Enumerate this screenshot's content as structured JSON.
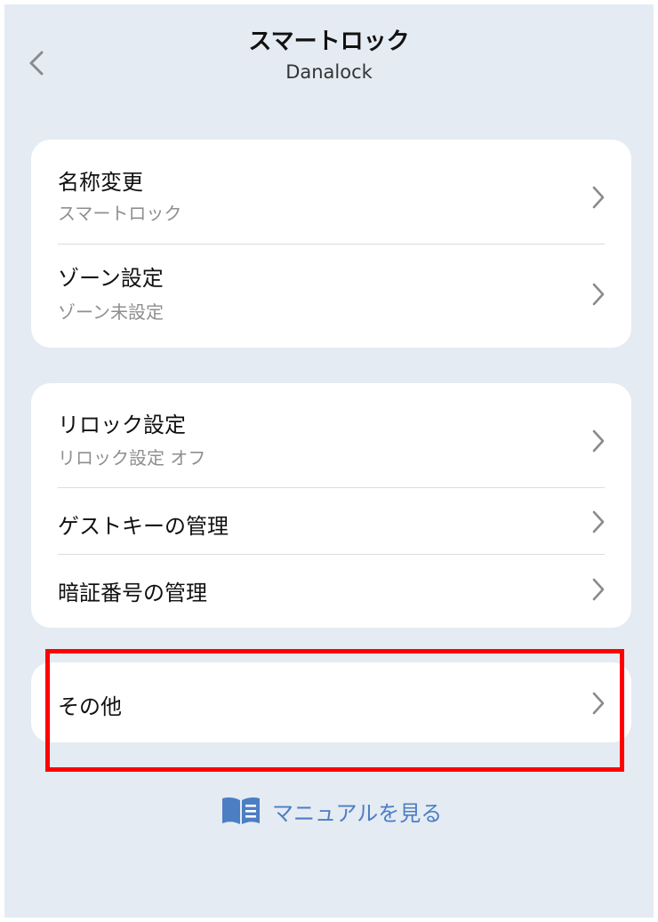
{
  "header": {
    "title": "スマートロック",
    "subtitle": "Danalock"
  },
  "groups": [
    {
      "items": [
        {
          "label": "名称変更",
          "sublabel": "スマートロック"
        },
        {
          "label": "ゾーン設定",
          "sublabel": "ゾーン未設定"
        }
      ]
    },
    {
      "items": [
        {
          "label": "リロック設定",
          "sublabel": "リロック設定 オフ"
        },
        {
          "label": "ゲストキーの管理"
        },
        {
          "label": "暗証番号の管理"
        }
      ]
    },
    {
      "items": [
        {
          "label": "その他"
        }
      ]
    }
  ],
  "manual_link": {
    "label": "マニュアルを見る"
  },
  "icons": {
    "back": "chevron-left-icon",
    "row_arrow": "chevron-right-icon",
    "manual": "book-icon"
  },
  "colors": {
    "background": "#e5ebf3",
    "card": "#ffffff",
    "link": "#4c7ec3",
    "highlight": "#ff0000"
  }
}
